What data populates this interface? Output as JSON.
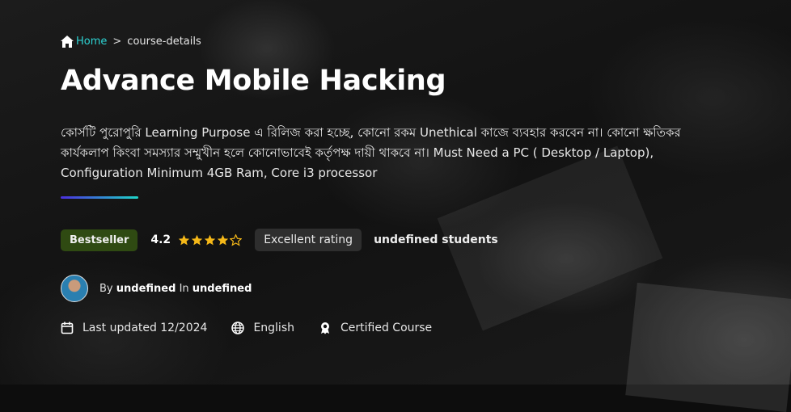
{
  "breadcrumb": {
    "home_label": "Home",
    "separator": ">",
    "current": "course-details"
  },
  "title": "Advance Mobile Hacking",
  "description": "কোর্সটি পুরোপুরি Learning Purpose এ রিলিজ করা হচ্ছে, কোনো রকম Unethical কাজে ব্যবহার করবেন না। কোনো ক্ষতিকর কার্যকলাপ কিংবা সমস্যার সম্মুখীন হলে কোনোভাবেই কর্তৃপক্ষ দায়ী থাকবে না। Must Need a PC ( Desktop / Laptop), Configuration Minimum 4GB Ram, Core i3 processor",
  "stats": {
    "badge": "Bestseller",
    "rating": "4.2",
    "stars_filled": 4,
    "stars_total": 5,
    "rating_label": "Excellent rating",
    "students": "undefined students"
  },
  "author": {
    "by": "By",
    "name": "undefined",
    "in": "In",
    "category": "undefined"
  },
  "meta": {
    "updated": "Last updated 12/2024",
    "language": "English",
    "certificate": "Certified Course"
  },
  "colors": {
    "accent_cyan": "#2dd4d4",
    "star": "#f5b818",
    "badge_bg": "#2f4a12"
  },
  "icons": [
    "home-icon",
    "star-icon",
    "avatar",
    "calendar-icon",
    "globe-icon",
    "award-icon"
  ]
}
